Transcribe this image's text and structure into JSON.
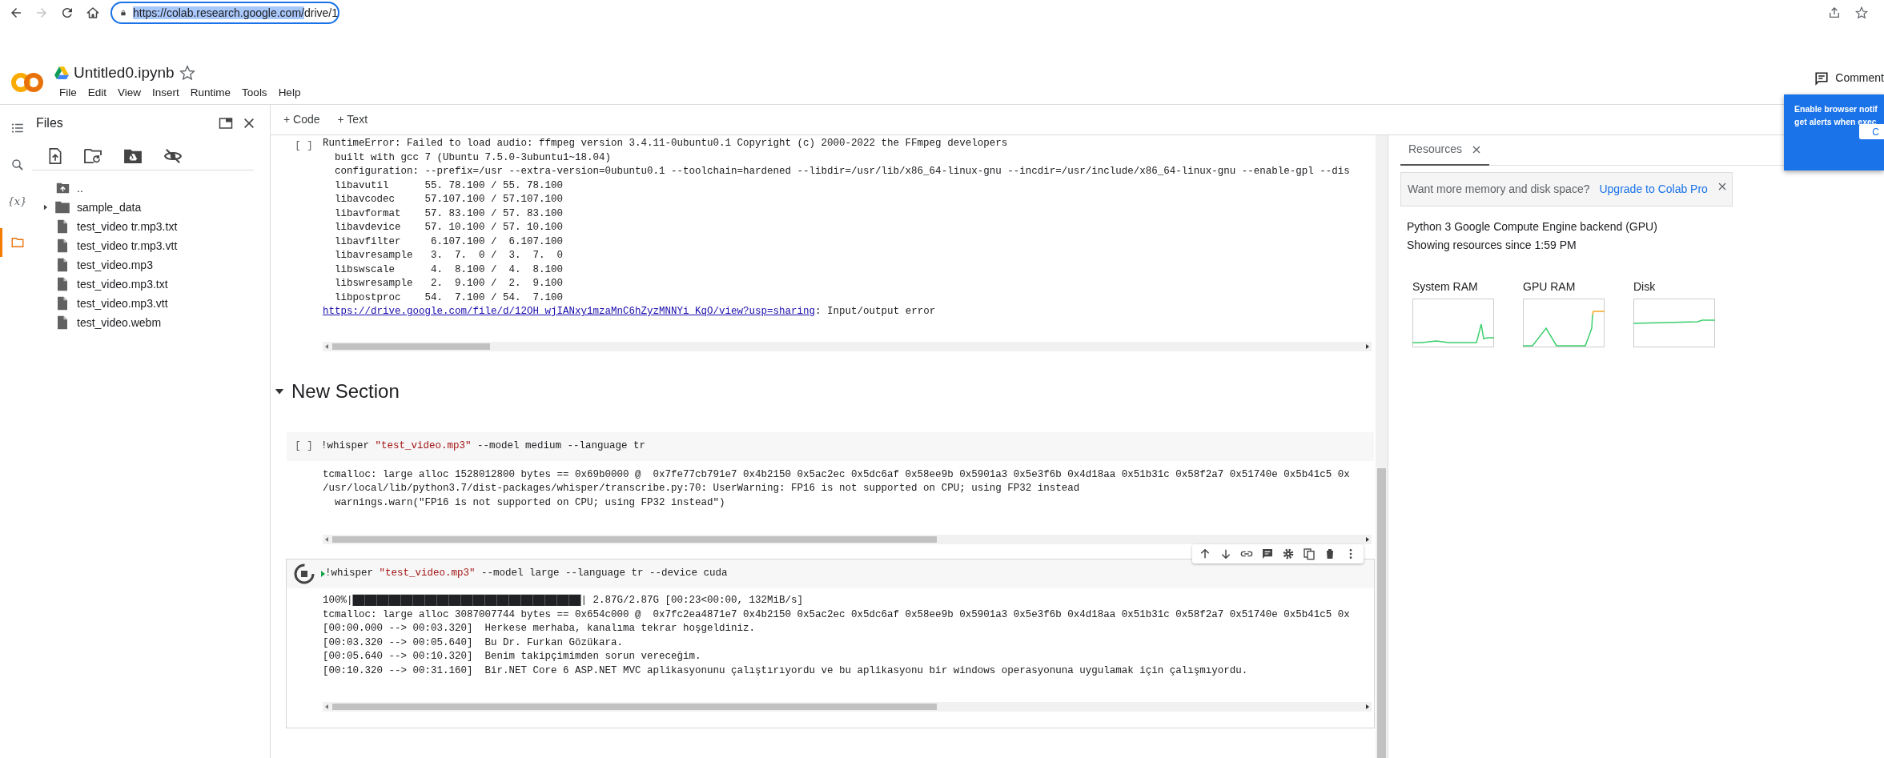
{
  "browser": {
    "nav": [
      {
        "kind": "back",
        "disabled": false
      },
      {
        "kind": "forward",
        "disabled": true
      },
      {
        "kind": "reload",
        "disabled": false
      },
      {
        "kind": "home",
        "disabled": false
      }
    ],
    "url_selected": "https://colab.research.google.com/",
    "url_rest": "drive/1"
  },
  "notebook_title": "Untitled0.ipynb",
  "starred": false,
  "menu": [
    "File",
    "Edit",
    "View",
    "Insert",
    "Runtime",
    "Tools",
    "Help"
  ],
  "comment": "Comment",
  "notification": {
    "lines": [
      "Enable browser notif",
      "get alerts when exec"
    ],
    "button": "C"
  },
  "rail": [
    {
      "kind": "toc",
      "selected": false
    },
    {
      "kind": "search",
      "selected": false
    },
    {
      "kind": "variables",
      "label": "{x}",
      "selected": false
    },
    {
      "kind": "files",
      "selected": true
    }
  ],
  "files_panel": {
    "title": "Files",
    "items": [
      {
        "kind": "parent",
        "name": ".."
      },
      {
        "kind": "folder",
        "name": "sample_data",
        "expanded": false
      },
      {
        "kind": "file",
        "name": "test_video tr.mp3.txt"
      },
      {
        "kind": "file",
        "name": "test_video tr.mp3.vtt"
      },
      {
        "kind": "file",
        "name": "test_video.mp3"
      },
      {
        "kind": "file",
        "name": "test_video.mp3.txt"
      },
      {
        "kind": "file",
        "name": "test_video.mp3.vtt"
      },
      {
        "kind": "file",
        "name": "test_video.webm"
      }
    ]
  },
  "toolbar": [
    "+ Code",
    "+ Text"
  ],
  "cells": [
    {
      "kind": "code",
      "run_label": "[ ]",
      "running": false,
      "focused": false,
      "output": [
        {
          "kind": "text",
          "text": "RuntimeError: Failed to load audio: ffmpeg version 3.4.11-0ubuntu0.1 Copyright (c) 2000-2022 the FFmpeg developers"
        },
        {
          "kind": "text",
          "text": "  built with gcc 7 (Ubuntu 7.5.0-3ubuntu1~18.04)"
        },
        {
          "kind": "text",
          "text": "  configuration: --prefix=/usr --extra-version=0ubuntu0.1 --toolchain=hardened --libdir=/usr/lib/x86_64-linux-gnu --incdir=/usr/include/x86_64-linux-gnu --enable-gpl --dis"
        },
        {
          "kind": "text",
          "text": "  libavutil      55. 78.100 / 55. 78.100"
        },
        {
          "kind": "text",
          "text": "  libavcodec     57.107.100 / 57.107.100"
        },
        {
          "kind": "text",
          "text": "  libavformat    57. 83.100 / 57. 83.100"
        },
        {
          "kind": "text",
          "text": "  libavdevice    57. 10.100 / 57. 10.100"
        },
        {
          "kind": "text",
          "text": "  libavfilter     6.107.100 /  6.107.100"
        },
        {
          "kind": "text",
          "text": "  libavresample   3.  7.  0 /  3.  7.  0"
        },
        {
          "kind": "text",
          "text": "  libswscale      4.  8.100 /  4.  8.100"
        },
        {
          "kind": "text",
          "text": "  libswresample   2.  9.100 /  2.  9.100"
        },
        {
          "kind": "text",
          "text": "  libpostproc    54.  7.100 / 54.  7.100"
        },
        {
          "kind": "link",
          "link": "https://drive.google.com/file/d/12OH_wjIANxy1mzaMnC6hZyzMNNYi_KqO/view?usp=sharing",
          "text": ": Input/output error"
        }
      ]
    },
    {
      "kind": "section",
      "title": "New Section",
      "expanded": true
    },
    {
      "kind": "code",
      "run_label": "[ ]",
      "running": false,
      "focused": false,
      "code": [
        {
          "kind": "plain",
          "text": "!whisper "
        },
        {
          "kind": "string",
          "text": "\"test_video.mp3\""
        },
        {
          "kind": "plain",
          "text": " --model medium --language tr"
        }
      ],
      "output": [
        {
          "kind": "text",
          "text": "tcmalloc: large alloc 1528012800 bytes == 0x69b0000 @  0x7fe77cb791e7 0x4b2150 0x5ac2ec 0x5dc6af 0x58ee9b 0x5901a3 0x5e3f6b 0x4d18aa 0x51b31c 0x58f2a7 0x51740e 0x5b41c5 0x"
        },
        {
          "kind": "text",
          "text": "/usr/local/lib/python3.7/dist-packages/whisper/transcribe.py:70: UserWarning: FP16 is not supported on CPU; using FP32 instead"
        },
        {
          "kind": "text",
          "text": "  warnings.warn(\"FP16 is not supported on CPU; using FP32 instead\")"
        }
      ]
    },
    {
      "kind": "code",
      "running": true,
      "focused": true,
      "code": [
        {
          "kind": "plain",
          "text": "!whisper "
        },
        {
          "kind": "string",
          "text": "\"test_video.mp3\""
        },
        {
          "kind": "plain",
          "text": " --model large --language tr --device cuda"
        }
      ],
      "output": [
        {
          "kind": "text",
          "text": "100%|██████████████████████████████████████| 2.87G/2.87G [00:23<00:00, 132MiB/s]"
        },
        {
          "kind": "text",
          "text": "tcmalloc: large alloc 3087007744 bytes == 0x654c000 @  0x7fc2ea4871e7 0x4b2150 0x5ac2ec 0x5dc6af 0x58ee9b 0x5901a3 0x5e3f6b 0x4d18aa 0x51b31c 0x58f2a7 0x51740e 0x5b41c5 0x"
        },
        {
          "kind": "text",
          "text": "[00:00.000 --> 00:03.320]  Herkese merhaba, kanalıma tekrar hoşgeldiniz."
        },
        {
          "kind": "text",
          "text": "[00:03.320 --> 00:05.640]  Bu Dr. Furkan Gözükara."
        },
        {
          "kind": "text",
          "text": "[00:05.640 --> 00:10.320]  Benim takipçimimden sorun vereceğim."
        },
        {
          "kind": "text",
          "text": "[00:10.320 --> 00:31.160]  Bir.NET Core 6 ASP.NET MVC aplikasyonunu çalıştırıyordu ve bu aplikasyonu bir windows operasyonuna uygulamak için çalışmıyordu."
        }
      ]
    }
  ],
  "resources": {
    "tab": "Resources",
    "banner": {
      "text": "Want more memory and disk space?",
      "link": "Upgrade to Colab Pro"
    },
    "backend": "Python 3 Google Compute Engine backend (GPU)",
    "since": "Showing resources since 1:59 PM",
    "graphs": [
      {
        "label": "System RAM"
      },
      {
        "label": "GPU RAM"
      },
      {
        "label": "Disk"
      }
    ]
  }
}
